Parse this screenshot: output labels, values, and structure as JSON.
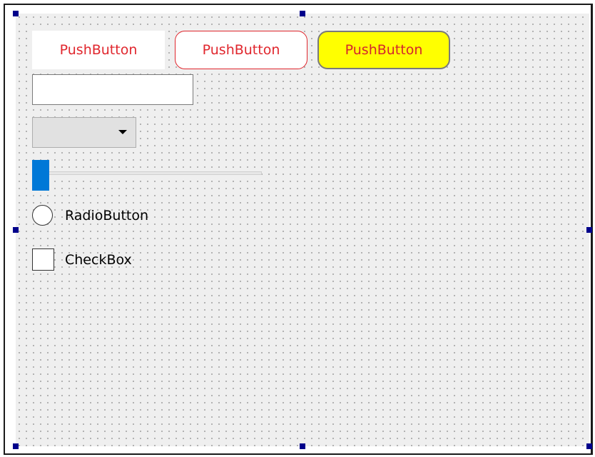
{
  "form": {
    "push_buttons": [
      {
        "label": "PushButton",
        "style": "flat-white",
        "text_color": "#e0262d"
      },
      {
        "label": "PushButton",
        "style": "rounded-red-border",
        "text_color": "#e0262d",
        "border_color": "#e0262d"
      },
      {
        "label": "PushButton",
        "style": "rounded-yellow",
        "text_color": "#d4262d",
        "background": "#ffff00",
        "border_color": "#7a7a7a"
      }
    ],
    "line_edit": {
      "value": "",
      "placeholder": ""
    },
    "combo_box": {
      "selected": "",
      "icon": "chevron-down-icon"
    },
    "slider": {
      "value_fraction": 0.0,
      "handle_color": "#0078d7"
    },
    "radio_button": {
      "label": "RadioButton",
      "checked": false
    },
    "check_box": {
      "label": "CheckBox",
      "checked": false
    }
  },
  "selection_handles": {
    "color": "#00008b",
    "positions": [
      "top-left",
      "top-center",
      "middle-left",
      "middle-right",
      "bottom-left",
      "bottom-center",
      "bottom-right"
    ]
  },
  "canvas": {
    "background": "#efefef",
    "grid": "dotted"
  }
}
